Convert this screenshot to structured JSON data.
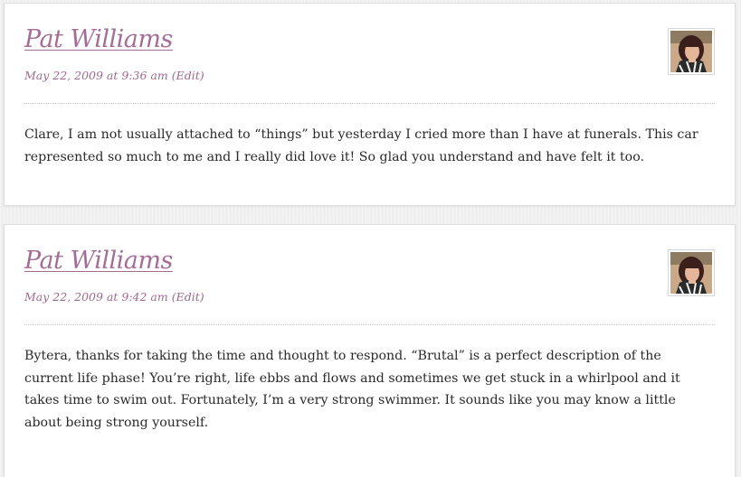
{
  "comments": [
    {
      "author": "Pat Williams",
      "date": "May 22, 2009 at 9:36 am",
      "edit_label": "(Edit)",
      "avatar_icon": "user-avatar-photo",
      "text": "Clare, I am not usually attached to “things” but yesterday I cried more than I have at funerals. This car represented so much to me and I really did love it! So glad you understand and have felt it too."
    },
    {
      "author": "Pat Williams",
      "date": "May 22, 2009 at 9:42 am",
      "edit_label": "(Edit)",
      "avatar_icon": "user-avatar-photo",
      "text": "Bytera, thanks for taking the time and thought to respond. “Brutal” is a perfect description of the current life phase! You’re right, life ebbs and flows and sometimes we get stuck in a whirlpool and it takes time to swim out. Fortunately, I’m a very strong swimmer. It sounds like you may know a little about being strong yourself."
    }
  ],
  "colors": {
    "accent": "#a46d95",
    "text": "#2a2a2a",
    "background": "#efefef",
    "card": "#ffffff"
  }
}
